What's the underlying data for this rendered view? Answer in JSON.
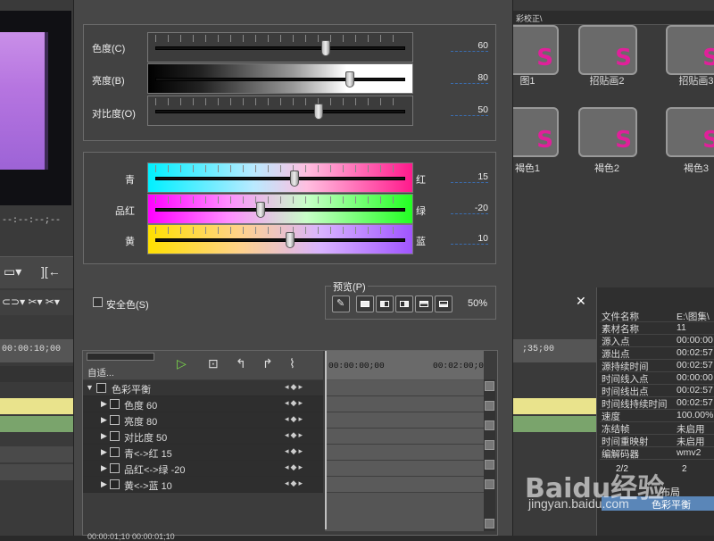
{
  "background": {
    "left_timecode": "--:--:--;--",
    "left_ruler_timecode": "00:00:10;00",
    "right_ruler_timecode": ";35;00",
    "effects_header": "彩校正\\",
    "effects": [
      {
        "label": "图1"
      },
      {
        "label": "招贴画2"
      },
      {
        "label": "招贴画3"
      },
      {
        "label": "褐色1"
      },
      {
        "label": "褐色2"
      },
      {
        "label": "褐色3"
      }
    ],
    "effect_letter": "S",
    "properties": [
      {
        "k": "文件名称",
        "v": "E:\\图集\\"
      },
      {
        "k": "素材名称",
        "v": "11"
      },
      {
        "k": "源入点",
        "v": "00:00:00"
      },
      {
        "k": "源出点",
        "v": "00:02:57"
      },
      {
        "k": "源持续时间",
        "v": "00:02:57"
      },
      {
        "k": "时间线入点",
        "v": "00:00:00"
      },
      {
        "k": "时间线出点",
        "v": "00:02:57"
      },
      {
        "k": "时间线持续时间",
        "v": "00:02:57"
      },
      {
        "k": "速度",
        "v": "100.00%"
      },
      {
        "k": "冻结帧",
        "v": "未启用"
      },
      {
        "k": "时间重映射",
        "v": "未启用"
      },
      {
        "k": "编解码器",
        "v": "wmv2"
      }
    ],
    "bottom_counts": [
      "2/2",
      "2"
    ],
    "bottom_items": [
      "布局",
      "色彩平衡"
    ],
    "close_symbol": "✕",
    "watermark": "Baidu经验",
    "watermark_sub": "jingyan.baidu.com"
  },
  "dialog": {
    "sliders_top": [
      {
        "label": "色度(C)",
        "value": "60",
        "pos": 0.69
      },
      {
        "label": "亮度(B)",
        "value": "80",
        "pos": 0.79
      },
      {
        "label": "对比度(O)",
        "value": "50",
        "pos": 0.66
      }
    ],
    "sliders_color": [
      {
        "label": "青",
        "right": "红",
        "value": "15",
        "pos": 0.56
      },
      {
        "label": "品红",
        "right": "绿",
        "value": "-20",
        "pos": 0.42
      },
      {
        "label": "黄",
        "right": "蓝",
        "value": "10",
        "pos": 0.54
      }
    ],
    "safe_color_label": "安全色(S)",
    "preview_label": "预览(P)",
    "preview_zoom": "50%",
    "keyframe": {
      "zoom_label": "自适...",
      "ruler_start": "00:00:00;00",
      "ruler_mark": "00:02:00;0",
      "rows": [
        {
          "label": "色彩平衡",
          "head": true
        },
        {
          "label": "色度  60"
        },
        {
          "label": "亮度  80"
        },
        {
          "label": "对比度  50"
        },
        {
          "label": "青<->红  15"
        },
        {
          "label": "品红<->绿  -20"
        },
        {
          "label": "黄<->蓝  10"
        }
      ],
      "footer": "00:00:01;10  00:00:01;10"
    }
  }
}
